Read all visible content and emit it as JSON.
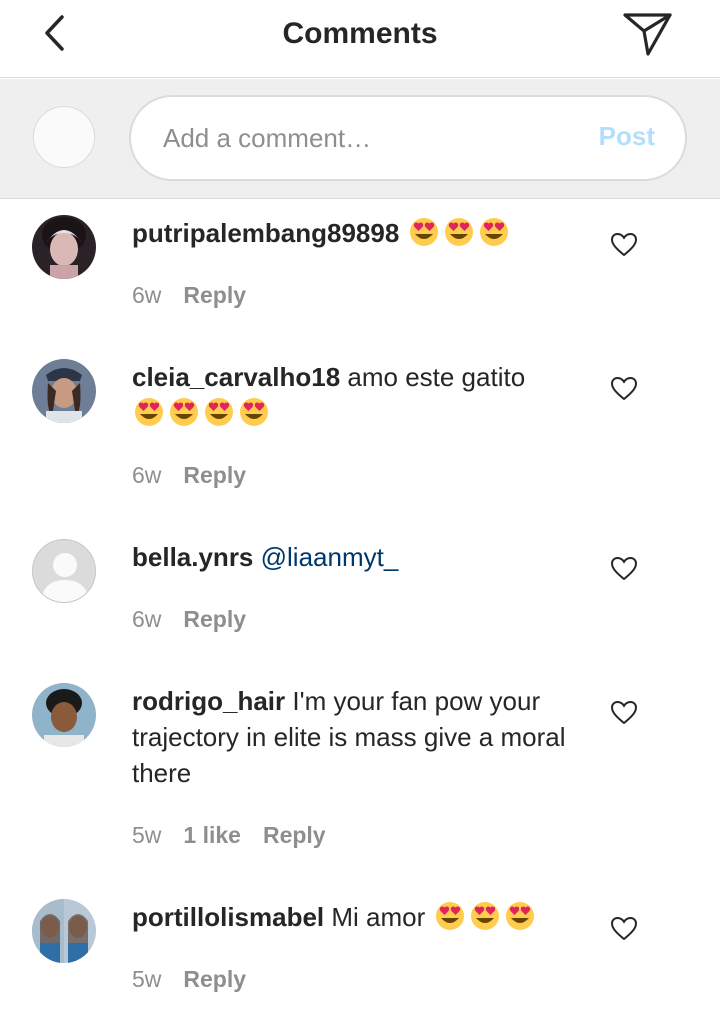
{
  "header": {
    "title": "Comments"
  },
  "composer": {
    "placeholder": "Add a comment…",
    "post_label": "Post"
  },
  "comments": [
    {
      "username": "putripalembang89898",
      "text": "",
      "emojis": [
        "heart-eyes",
        "heart-eyes",
        "heart-eyes"
      ],
      "time": "6w",
      "likes": "",
      "reply": "Reply"
    },
    {
      "username": "cleia_carvalho18",
      "text": "amo este gatito",
      "emojis": [
        "heart-eyes",
        "heart-eyes",
        "heart-eyes",
        "heart-eyes"
      ],
      "time": "6w",
      "likes": "",
      "reply": "Reply"
    },
    {
      "username": "bella.ynrs",
      "mention": "@liaanmyt_",
      "time": "6w",
      "likes": "",
      "reply": "Reply"
    },
    {
      "username": "rodrigo_hair",
      "text": "I'm your fan pow your trajectory in elite is mass give a moral there",
      "time": "5w",
      "likes": "1 like",
      "reply": "Reply"
    },
    {
      "username": "portillolismabel",
      "text": "Mi amor",
      "emojis": [
        "heart-eyes",
        "heart-eyes",
        "heart-eyes"
      ],
      "time": "5w",
      "likes": "",
      "reply": "Reply"
    }
  ],
  "colors": {
    "link": "#00376b",
    "muted": "#8e8e8e",
    "post_disabled": "#b2dffc",
    "composer_bg": "#efefef"
  }
}
